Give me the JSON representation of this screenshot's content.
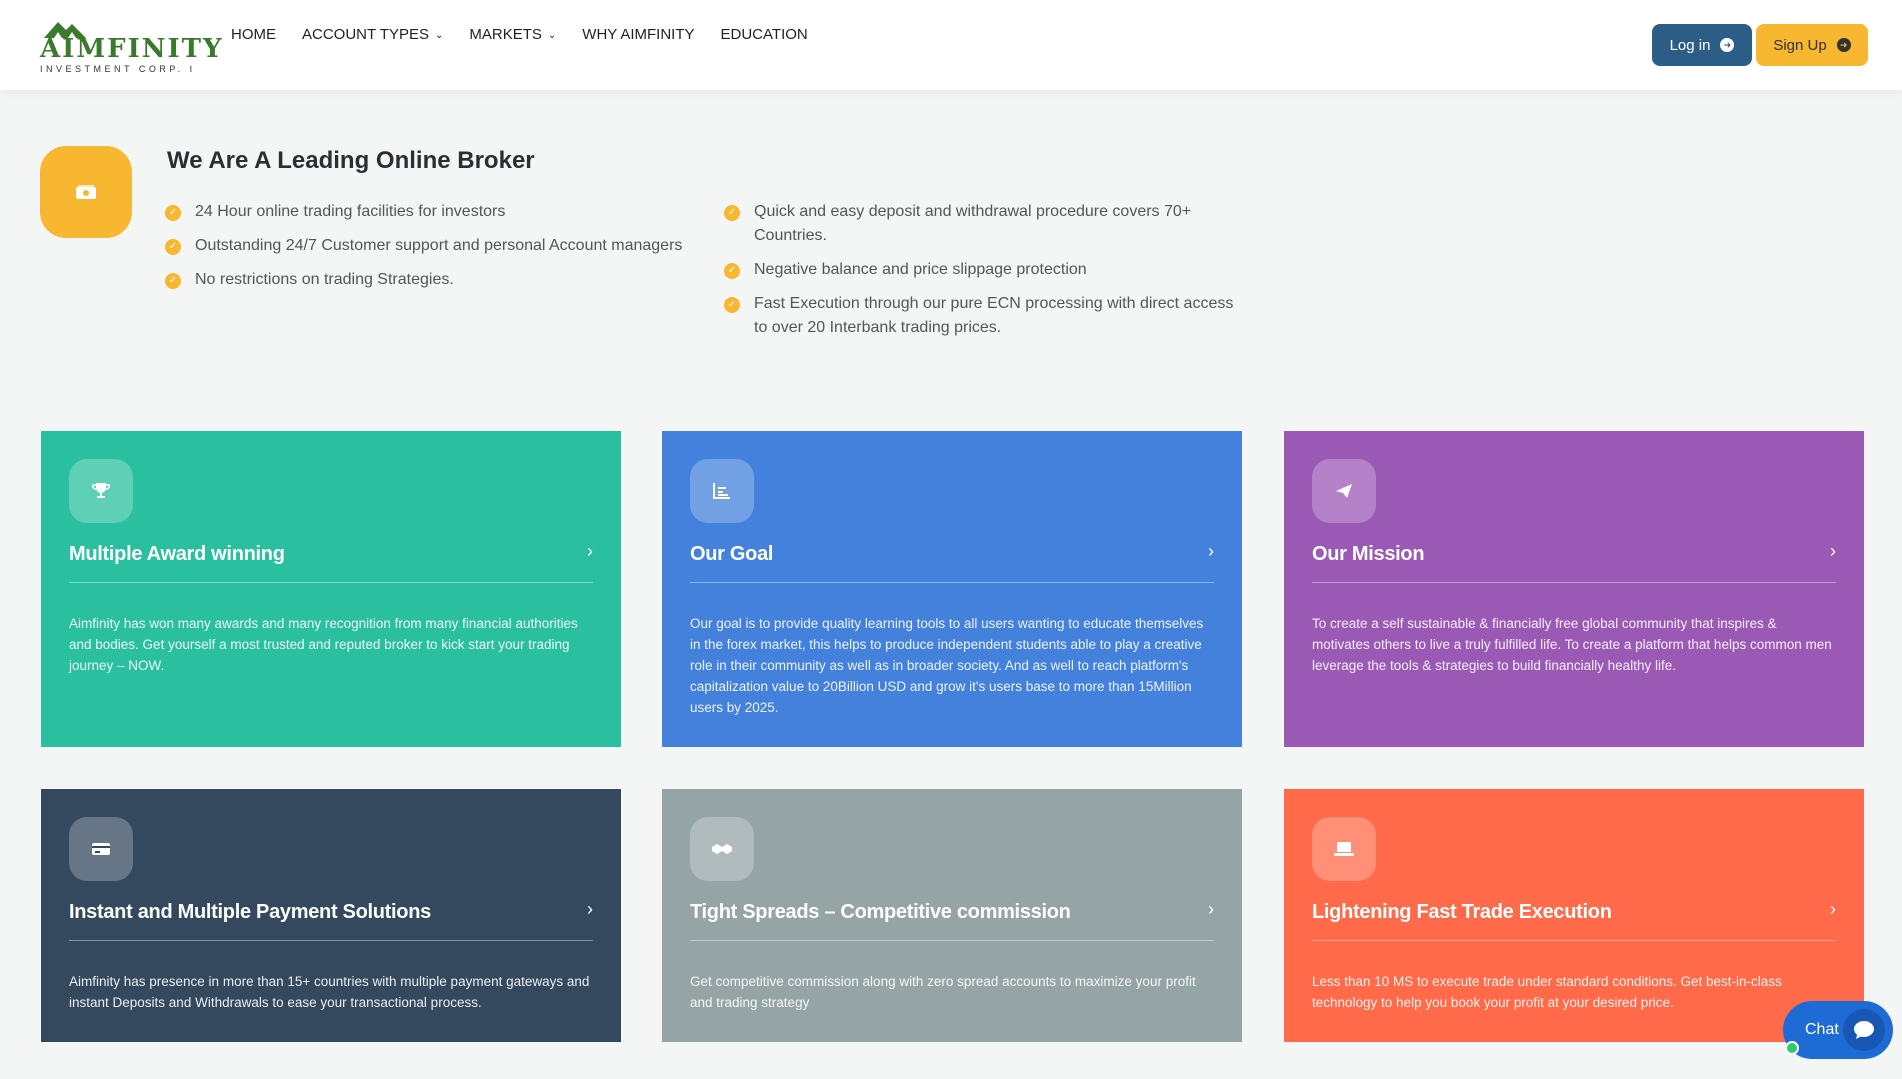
{
  "header": {
    "logo_text": "AIMFINITY",
    "logo_sub": "INVESTMENT CORP. I",
    "nav": [
      {
        "label": "HOME",
        "dropdown": false
      },
      {
        "label": "ACCOUNT TYPES",
        "dropdown": true
      },
      {
        "label": "MARKETS",
        "dropdown": true
      },
      {
        "label": "WHY AIMFINITY",
        "dropdown": false
      },
      {
        "label": "EDUCATION",
        "dropdown": false
      }
    ],
    "login_label": "Log in",
    "signup_label": "Sign Up"
  },
  "broker": {
    "title": "We Are A Leading Online Broker",
    "icon": "money-icon",
    "left_features": [
      "24 Hour online trading facilities for investors",
      "Outstanding 24/7 Customer support and personal Account managers",
      "No restrictions on trading Strategies."
    ],
    "right_features": [
      "Quick and easy deposit and withdrawal procedure covers 70+ Countries.",
      "Negative balance and price slippage protection",
      "Fast Execution through our pure ECN processing with direct access to over 20 Interbank trading prices."
    ]
  },
  "cards": [
    {
      "title": "Multiple Award winning",
      "icon": "trophy-icon",
      "color": "#2abf9e",
      "text": "Aimfinity has won many awards and many recognition from many financial authorities and bodies. Get yourself a most trusted and reputed broker to kick start your trading journey – NOW."
    },
    {
      "title": "Our Goal",
      "icon": "chart-icon",
      "color": "#4381dc",
      "text": "Our goal is to provide quality learning tools to all users wanting to educate themselves in the forex market, this helps to produce independent students able to play a creative role in their community as well as in broader society. And as well to reach platform's capitalization value to 20Billion USD and grow it's users base to more than 15Million users by 2025."
    },
    {
      "title": "Our Mission",
      "icon": "paper-plane-icon",
      "color": "#9b59b6",
      "text": "To create a self sustainable & financially free global community that inspires & motivates others to live a truly fulfilled life. To create a platform that helps common men leverage the tools & strategies to build financially healthy life."
    },
    {
      "title": "Instant and Multiple Payment Solutions",
      "icon": "credit-card-icon",
      "color": "#34495e",
      "text": "Aimfinity has presence in more than 15+ countries with multiple payment gateways and instant Deposits and Withdrawals to ease your transactional process."
    },
    {
      "title": "Tight Spreads – Competitive commission",
      "icon": "handshake-icon",
      "color": "#95a5a6",
      "text": "Get competitive commission along with zero spread accounts to maximize your profit and trading strategy"
    },
    {
      "title": "Lightening Fast Trade Execution",
      "icon": "laptop-icon",
      "color": "#ff6b4a",
      "text": "Less than 10 MS to execute trade under standard conditions. Get best-in-class technology to help you book your profit at your desired price."
    }
  ],
  "chat": {
    "label": "Chat"
  }
}
